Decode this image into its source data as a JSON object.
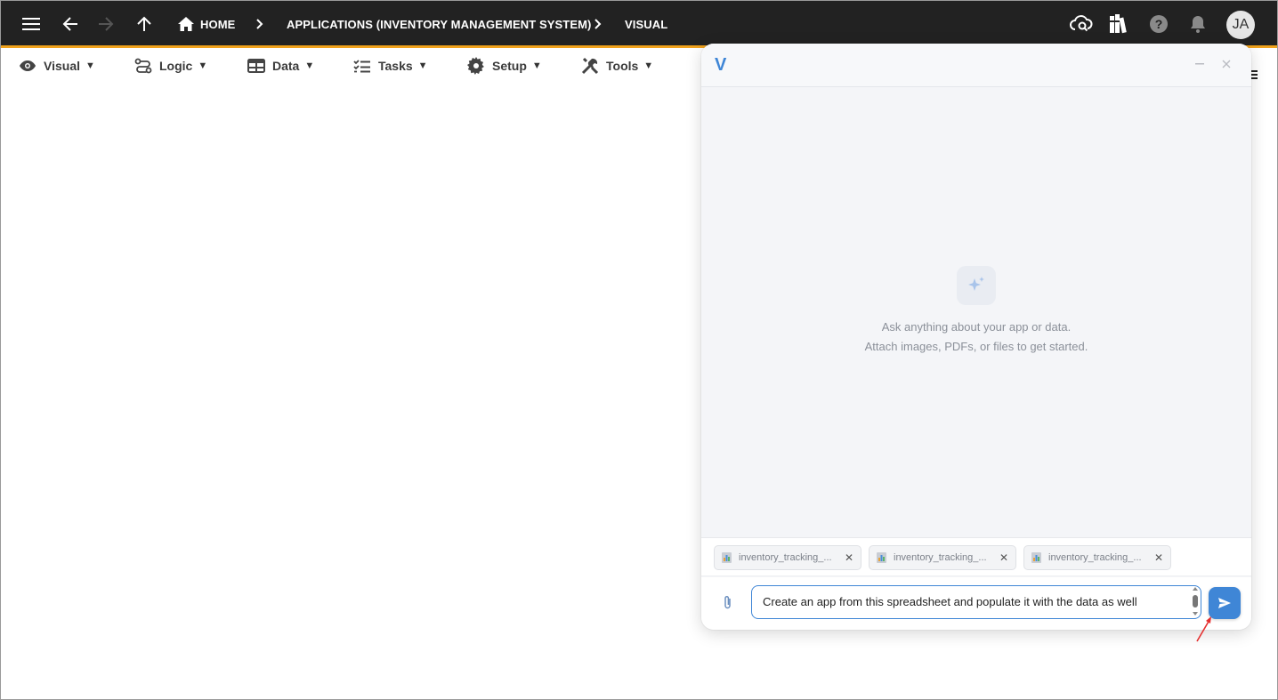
{
  "topbar": {
    "breadcrumb": [
      "HOME",
      "APPLICATIONS (INVENTORY MANAGEMENT SYSTEM)",
      "VISUAL"
    ],
    "avatar_initials": "JA",
    "accent_color": "#f0a21c",
    "icons": [
      "hamburger-menu-icon",
      "back-arrow-icon",
      "forward-arrow-icon",
      "up-arrow-icon",
      "home-icon",
      "cloud-search-icon",
      "library-icon",
      "help-icon",
      "bell-icon"
    ]
  },
  "menubar": {
    "items": [
      {
        "label": "Visual",
        "icon": "eye-icon"
      },
      {
        "label": "Logic",
        "icon": "logic-icon"
      },
      {
        "label": "Data",
        "icon": "table-icon"
      },
      {
        "label": "Tasks",
        "icon": "checklist-icon"
      },
      {
        "label": "Setup",
        "icon": "gear-icon"
      },
      {
        "label": "Tools",
        "icon": "tools-icon"
      }
    ],
    "caret": "▼"
  },
  "chat": {
    "logo": "V",
    "empty_state": {
      "line1": "Ask anything about your app or data.",
      "line2": "Attach images, PDFs, or files to get started."
    },
    "attachments": [
      {
        "name": "inventory_tracking_..."
      },
      {
        "name": "inventory_tracking_..."
      },
      {
        "name": "inventory_tracking_..."
      }
    ],
    "input_value": "Create an app from this spreadsheet and populate it with the data as well",
    "brand_color": "#3f86d6"
  }
}
